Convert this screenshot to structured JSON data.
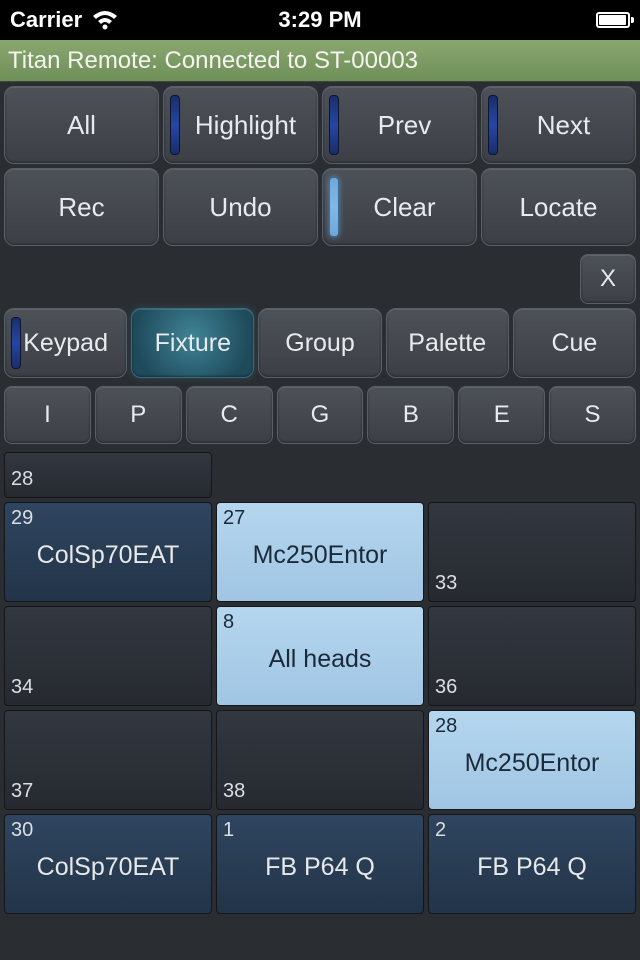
{
  "status": {
    "carrier": "Carrier",
    "time": "3:29 PM"
  },
  "connection": "Titan Remote: Connected to ST-00003",
  "top_buttons_row1": [
    "All",
    "Highlight",
    "Prev",
    "Next"
  ],
  "top_buttons_row2": [
    "Rec",
    "Undo",
    "Clear",
    "Locate"
  ],
  "x_label": "X",
  "modes": [
    "Keypad",
    "Fixture",
    "Group",
    "Palette",
    "Cue"
  ],
  "active_mode": 1,
  "attrs": [
    "I",
    "P",
    "C",
    "G",
    "B",
    "E",
    "S"
  ],
  "cells": {
    "half28": "28",
    "r1c1": {
      "num": "29",
      "label": "ColSp70EAT"
    },
    "r1c2": {
      "num": "27",
      "label": "Mc250Entor"
    },
    "r1c3": {
      "num": "33"
    },
    "r2c1": {
      "num": "34"
    },
    "r2c2": {
      "num": "8",
      "label": "All heads"
    },
    "r2c3": {
      "num": "36"
    },
    "r3c1": {
      "num": "37"
    },
    "r3c2": {
      "num": "38"
    },
    "r3c3": {
      "num": "28",
      "label": "Mc250Entor"
    },
    "r4c1": {
      "num": "30",
      "label": "ColSp70EAT"
    },
    "r4c2": {
      "num": "1",
      "label": "FB P64 Q"
    },
    "r4c3": {
      "num": "2",
      "label": "FB P64 Q"
    }
  }
}
